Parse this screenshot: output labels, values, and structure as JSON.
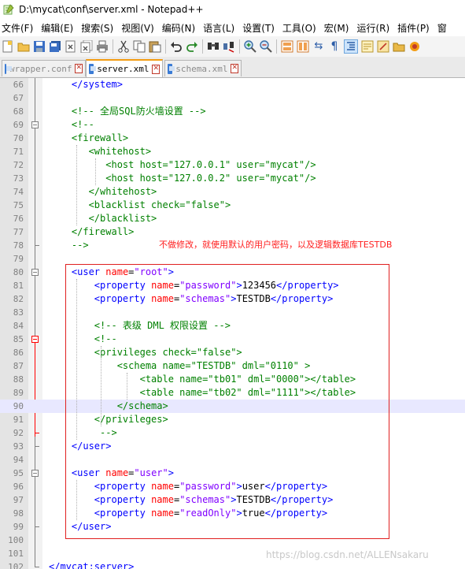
{
  "window": {
    "title": "D:\\mycat\\conf\\server.xml - Notepad++"
  },
  "menu": [
    "文件(F)",
    "编辑(E)",
    "搜索(S)",
    "视图(V)",
    "编码(N)",
    "语言(L)",
    "设置(T)",
    "工具(O)",
    "宏(M)",
    "运行(R)",
    "插件(P)",
    "窗"
  ],
  "tabs": [
    {
      "label": "wrapper.conf",
      "active": false
    },
    {
      "label": "server.xml",
      "active": true
    },
    {
      "label": "schema.xml",
      "active": false
    }
  ],
  "toolbar_icons": [
    "new-file-icon",
    "open-file-icon",
    "save-icon",
    "save-all-icon",
    "close-icon",
    "close-all-icon",
    "print-icon",
    "cut-icon",
    "copy-icon",
    "paste-icon",
    "undo-icon",
    "redo-icon",
    "find-icon",
    "replace-icon",
    "zoom-in-icon",
    "zoom-out-icon",
    "sync-v-icon",
    "sync-h-icon",
    "word-wrap-icon",
    "show-all-icon",
    "indent-guide-icon",
    "doc-map-icon",
    "function-list-icon",
    "folder-icon"
  ],
  "colors": {
    "tag": "#0000ff",
    "attr": "#ff0000",
    "value": "#8000ff",
    "comment": "#008000",
    "annotation": "#ff2020",
    "current_line": "#e8e8ff"
  },
  "annotation": "不做修改，就使用默认的用户密码，以及逻辑数据库TESTDB",
  "watermark": "https://blog.csdn.net/ALLENsakaru",
  "lines": [
    {
      "num": "66",
      "text": "    </system>"
    },
    {
      "num": "67",
      "text": ""
    },
    {
      "num": "68",
      "text": "    <!-- 全局SQL防火墙设置 -->"
    },
    {
      "num": "69",
      "text": "    <!--"
    },
    {
      "num": "70",
      "text": "    <firewall>"
    },
    {
      "num": "71",
      "text": "       <whitehost>"
    },
    {
      "num": "72",
      "text": "          <host host=\"127.0.0.1\" user=\"mycat\"/>"
    },
    {
      "num": "73",
      "text": "          <host host=\"127.0.0.2\" user=\"mycat\"/>"
    },
    {
      "num": "74",
      "text": "       </whitehost>"
    },
    {
      "num": "75",
      "text": "       <blacklist check=\"false\">"
    },
    {
      "num": "76",
      "text": "       </blacklist>"
    },
    {
      "num": "77",
      "text": "    </firewall>"
    },
    {
      "num": "78",
      "text": "    -->"
    },
    {
      "num": "79",
      "text": ""
    },
    {
      "num": "80",
      "text": "    <user name=\"root\">"
    },
    {
      "num": "81",
      "text": "        <property name=\"password\">123456</property>"
    },
    {
      "num": "82",
      "text": "        <property name=\"schemas\">TESTDB</property>"
    },
    {
      "num": "83",
      "text": ""
    },
    {
      "num": "84",
      "text": "        <!-- 表级 DML 权限设置 -->"
    },
    {
      "num": "85",
      "text": "        <!--"
    },
    {
      "num": "86",
      "text": "        <privileges check=\"false\">"
    },
    {
      "num": "87",
      "text": "            <schema name=\"TESTDB\" dml=\"0110\" >"
    },
    {
      "num": "88",
      "text": "                <table name=\"tb01\" dml=\"0000\"></table>"
    },
    {
      "num": "89",
      "text": "                <table name=\"tb02\" dml=\"1111\"></table>"
    },
    {
      "num": "90",
      "text": "            </schema>"
    },
    {
      "num": "91",
      "text": "        </privileges>"
    },
    {
      "num": "92",
      "text": "         -->"
    },
    {
      "num": "93",
      "text": "    </user>"
    },
    {
      "num": "94",
      "text": ""
    },
    {
      "num": "95",
      "text": "    <user name=\"user\">"
    },
    {
      "num": "96",
      "text": "        <property name=\"password\">user</property>"
    },
    {
      "num": "97",
      "text": "        <property name=\"schemas\">TESTDB</property>"
    },
    {
      "num": "98",
      "text": "        <property name=\"readOnly\">true</property>"
    },
    {
      "num": "99",
      "text": "    </user>"
    },
    {
      "num": "100",
      "text": ""
    },
    {
      "num": "101",
      "text": ""
    },
    {
      "num": "102",
      "text": "</mycat:server>"
    }
  ]
}
